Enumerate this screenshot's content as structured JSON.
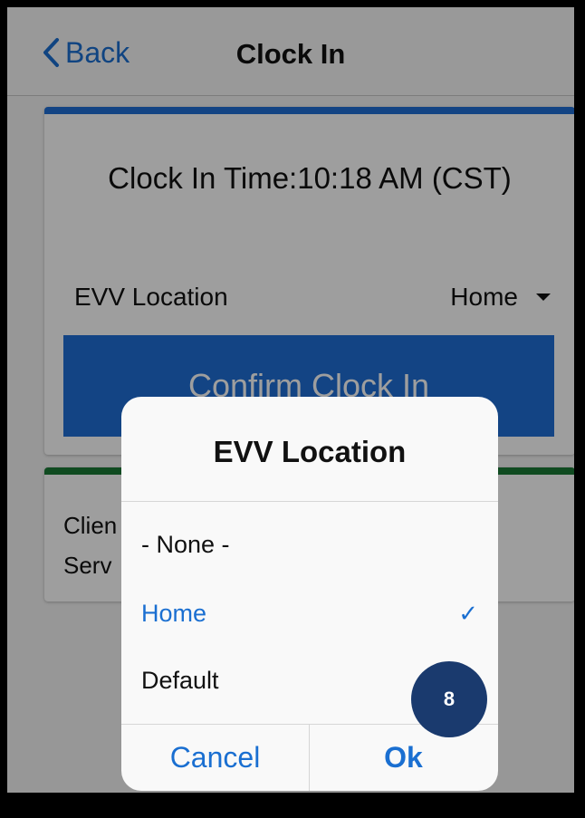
{
  "navbar": {
    "back_label": "Back",
    "title": "Clock In"
  },
  "clock_card": {
    "clock_in_time": "Clock In Time:10:18 AM (CST)",
    "evv_label": "EVV Location",
    "evv_value": "Home",
    "confirm_label": "Confirm Clock In",
    "accent_color": "#1f6fd6"
  },
  "client_card": {
    "line1": "Clien",
    "line2": "Serv",
    "accent_color": "#1b7a36"
  },
  "dialog": {
    "title": "EVV Location",
    "options": [
      {
        "label": "- None -",
        "selected": false
      },
      {
        "label": "Home",
        "selected": true
      },
      {
        "label": "Default",
        "selected": false
      }
    ],
    "check_mark": "✓",
    "cancel_label": "Cancel",
    "ok_label": "Ok"
  },
  "badge": {
    "text": "8"
  }
}
